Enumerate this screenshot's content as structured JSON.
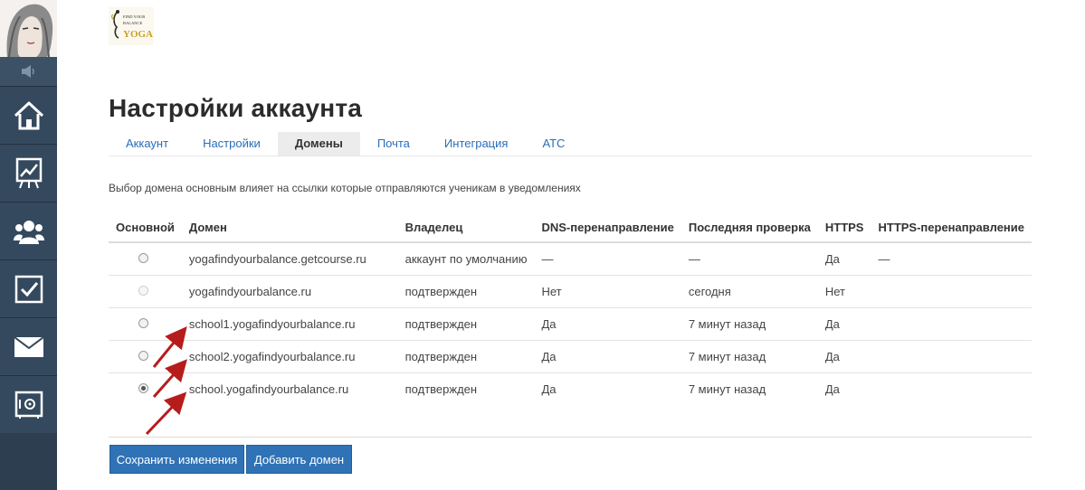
{
  "page": {
    "title": "Настройки аккаунта"
  },
  "tabs": [
    {
      "label": "Аккаунт",
      "active": false
    },
    {
      "label": "Настройки",
      "active": false
    },
    {
      "label": "Домены",
      "active": true
    },
    {
      "label": "Почта",
      "active": false
    },
    {
      "label": "Интеграция",
      "active": false
    },
    {
      "label": "АТС",
      "active": false
    }
  ],
  "hint": "Выбор домена основным влияет на ссылки которые отправляются ученикам в уведомлениях",
  "table": {
    "columns": [
      "Основной",
      "Домен",
      "Владелец",
      "DNS-перенаправление",
      "Последняя проверка",
      "HTTPS",
      "HTTPS-перенаправление"
    ],
    "rows": [
      {
        "radio": "unchecked",
        "domain": "yogafindyourbalance.getcourse.ru",
        "domain_link": false,
        "owner": "аккаунт по умолчанию",
        "dns": "—",
        "checked": "—",
        "https": "Да",
        "https_link": false,
        "https_redirect": "—"
      },
      {
        "radio": "disabled",
        "domain": "yogafindyourbalance.ru",
        "domain_link": true,
        "owner": "подтвержден",
        "dns": "Нет",
        "checked": "сегодня",
        "https": "Нет",
        "https_link": true,
        "https_redirect": ""
      },
      {
        "radio": "unchecked",
        "domain": "school1.yogafindyourbalance.ru",
        "domain_link": true,
        "owner": "подтвержден",
        "dns": "Да",
        "checked": "7 минут назад",
        "https": "Да",
        "https_link": true,
        "https_redirect": ""
      },
      {
        "radio": "unchecked",
        "domain": "school2.yogafindyourbalance.ru",
        "domain_link": true,
        "owner": "подтвержден",
        "dns": "Да",
        "checked": "7 минут назад",
        "https": "Да",
        "https_link": true,
        "https_redirect": ""
      },
      {
        "radio": "checked",
        "domain": "school.yogafindyourbalance.ru",
        "domain_link": true,
        "owner": "подтвержден",
        "dns": "Да",
        "checked": "7 минут назад",
        "https": "Да",
        "https_link": true,
        "https_redirect": ""
      }
    ]
  },
  "buttons": {
    "save": "Сохранить изменения",
    "add": "Добавить домен"
  },
  "sidebar": {
    "icons": [
      "speaker-icon",
      "home-icon",
      "chart-icon",
      "users-icon",
      "tasks-icon",
      "mail-icon",
      "safe-icon"
    ]
  },
  "logo": {
    "text_line1": "FIND YOUR",
    "text_line2": "BALANCE",
    "text_line3": "YOGA"
  },
  "colors": {
    "sidebar": "#34495e",
    "link": "#2a6ebb",
    "button": "#2f72b6",
    "arrow": "#b71c1c"
  }
}
